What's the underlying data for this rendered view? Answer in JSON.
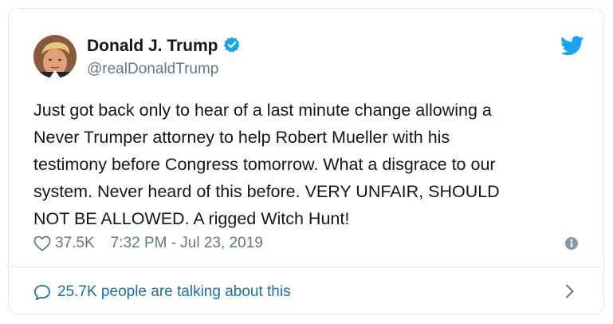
{
  "author": {
    "display_name": "Donald J. Trump",
    "handle": "@realDonaldTrump",
    "verified": true
  },
  "tweet": {
    "text": "Just got back only to hear of a last minute change allowing a\nNever Trumper attorney to help Robert Mueller with his\ntestimony before Congress tomorrow. What a disgrace to our\nsystem. Never heard of this before. VERY UNFAIR, SHOULD\nNOT BE ALLOWED. A rigged Witch Hunt!",
    "likes": "37.5K",
    "timestamp": "7:32 PM - Jul 23, 2019"
  },
  "footer": {
    "talking_label": "25.7K people are talking about this"
  },
  "icons": {
    "brand": "twitter-bird-icon",
    "verified": "verified-badge-icon",
    "like": "heart-icon",
    "info": "info-icon",
    "reply": "speech-bubble-icon",
    "more": "chevron-right-icon"
  },
  "colors": {
    "brand_blue": "#1da1f2",
    "link_blue": "#1b6fa8",
    "muted_gray": "#657786",
    "text": "#14171a",
    "border": "#e1e8ed"
  }
}
